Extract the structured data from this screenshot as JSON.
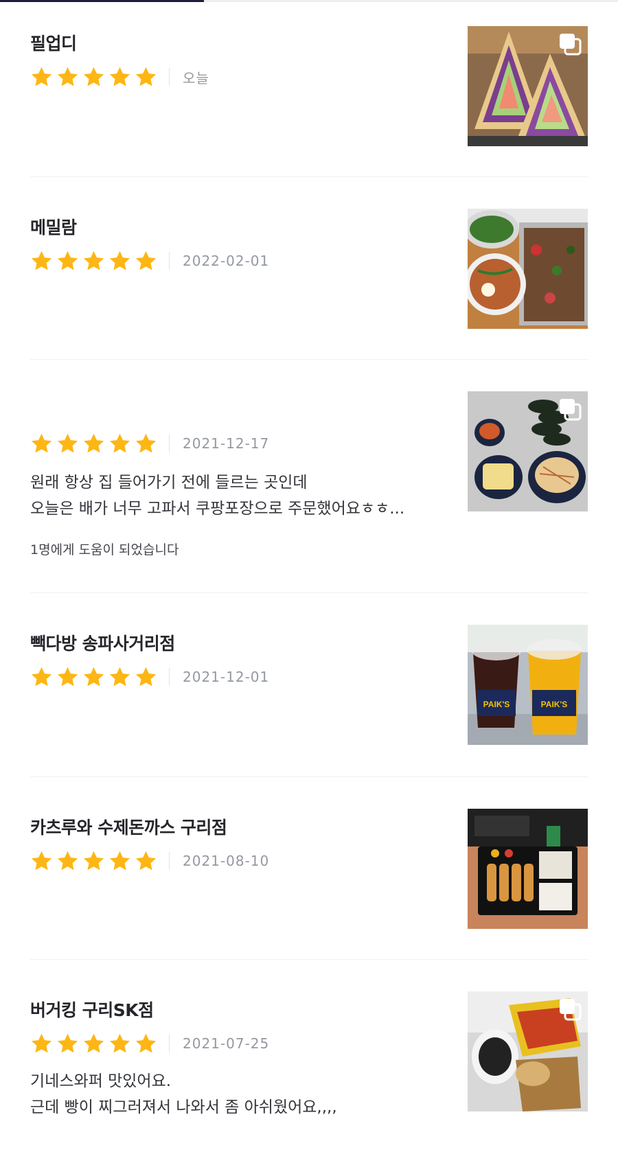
{
  "progress": {
    "fraction": 0.33
  },
  "colors": {
    "star": "#FDB614",
    "divider": "#EEF0F3",
    "date": "#9498A1",
    "title": "#25262B"
  },
  "reviews": [
    {
      "store": "필업디",
      "rating": 5,
      "date": "오늘",
      "text": "",
      "helpful": "",
      "photo": "sandwich-photo",
      "multi_photo": true
    },
    {
      "store": "메밀람",
      "rating": 5,
      "date": "2022-02-01",
      "text": "",
      "helpful": "",
      "photo": "buckwheat-noodle-photo",
      "multi_photo": false
    },
    {
      "store": "",
      "rating": 5,
      "date": "2021-12-17",
      "text": "원래 항상 집 들어가기 전에 들르는 곳인데\n오늘은 배가 너무 고파서 쿠팡포장으로 주문했어요ㅎㅎ...",
      "helpful": "1명에게 도움이 되었습니다",
      "photo": "kimbap-photo",
      "multi_photo": true
    },
    {
      "store": "빽다방 송파사거리점",
      "rating": 5,
      "date": "2021-12-01",
      "text": "",
      "helpful": "",
      "photo": "paiks-drinks-photo",
      "multi_photo": false
    },
    {
      "store": "카츠루와 수제돈까스 구리점",
      "rating": 5,
      "date": "2021-08-10",
      "text": "",
      "helpful": "",
      "photo": "tonkatsu-bento-photo",
      "multi_photo": false
    },
    {
      "store": "버거킹 구리SK점",
      "rating": 5,
      "date": "2021-07-25",
      "text": "기네스와퍼 맛있어요.\n근데 빵이 찌그러져서 나와서 좀 아쉬웠어요,,,,",
      "helpful": "",
      "photo": "burger-king-bag-photo",
      "multi_photo": true
    }
  ]
}
